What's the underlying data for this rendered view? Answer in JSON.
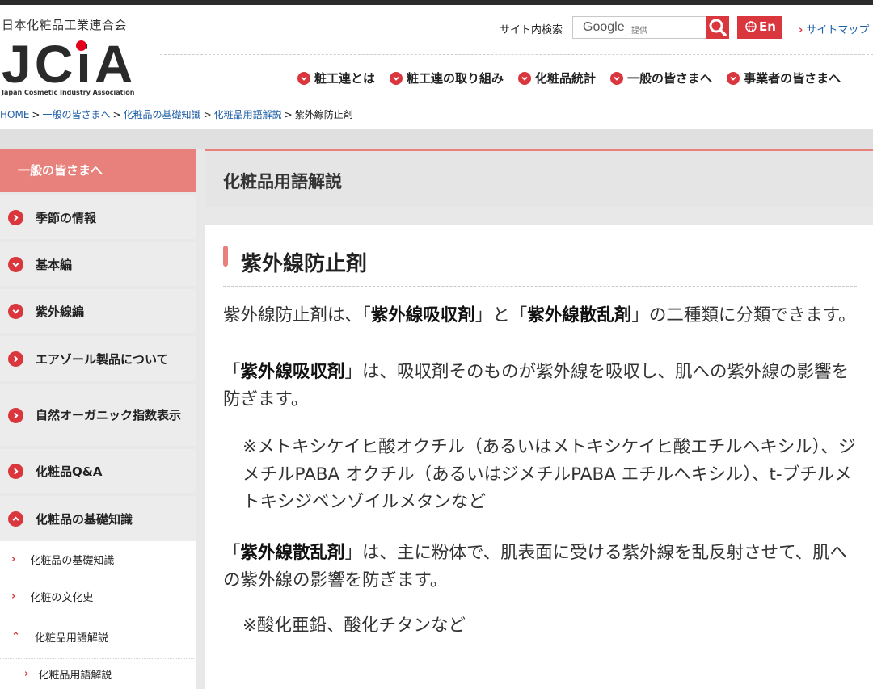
{
  "header": {
    "org_name": "日本化粧品工業連合会",
    "logo_text": "JCiA",
    "logo_sub": "Japan Cosmetic Industry Association",
    "search_label": "サイト内検索",
    "search_google": "Google",
    "search_provider": "提供",
    "en_label": "En",
    "sitemap_label": "サイトマップ",
    "nav": [
      {
        "label": "粧工連とは"
      },
      {
        "label": "粧工連の取り組み"
      },
      {
        "label": "化粧品統計"
      },
      {
        "label": "一般の皆さまへ"
      },
      {
        "label": "事業者の皆さまへ"
      }
    ],
    "accent_color": "#d9363e"
  },
  "breadcrumb": {
    "items": [
      "HOME",
      "一般の皆さまへ",
      "化粧品の基礎知識",
      "化粧品用語解説"
    ],
    "current": "紫外線防止剤",
    "sep": ">"
  },
  "sidebar": {
    "heading": "一般の皆さまへ",
    "items": [
      {
        "label": "季節の情報"
      },
      {
        "label": "基本編"
      },
      {
        "label": "紫外線編"
      },
      {
        "label": "エアゾール製品について"
      },
      {
        "label": "自然オーガニック指数表示"
      },
      {
        "label": "化粧品Q&A"
      },
      {
        "label": "化粧品の基礎知識"
      }
    ],
    "subitems": [
      {
        "label": "化粧品の基礎知識"
      },
      {
        "label": "化粧の文化史"
      },
      {
        "label": "化粧品用語解説"
      },
      {
        "label": "化粧品用語解説"
      }
    ]
  },
  "content": {
    "section_title": "化粧品用語解説",
    "title": "紫外線防止剤",
    "p1_a": "紫外線防止剤は、「",
    "p1_b": "紫外線吸収剤",
    "p1_c": "」と「",
    "p1_d": "紫外線散乱剤",
    "p1_e": "」の二種類に分類できます。",
    "p2_a": "「",
    "p2_b": "紫外線吸収剤",
    "p2_c": "」は、吸収剤そのものが紫外線を吸収し、肌への紫外線の影響を防ぎます。",
    "note1": "※メトキシケイヒ酸オクチル（あるいはメトキシケイヒ酸エチルヘキシル）、ジメチルPABA オクチル（あるいはジメチルPABA エチルヘキシル）、t-ブチルメトキシジベンゾイルメタンなど",
    "p3_a": "「",
    "p3_b": "紫外線散乱剤",
    "p3_c": "」は、主に粉体で、肌表面に受ける紫外線を乱反射させて、肌への紫外線の影響を防ぎます。",
    "note2": "※酸化亜鉛、酸化チタンなど"
  }
}
